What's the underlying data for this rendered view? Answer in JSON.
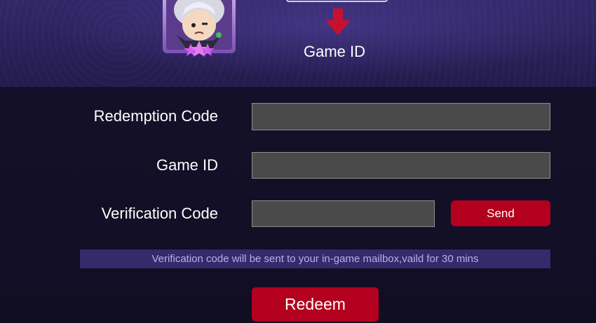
{
  "hero": {
    "game_id_label": "Game ID",
    "avatar_icon": "hero-avatar-icon",
    "arrow_icon": "down-arrow-icon",
    "arrow_color": "#c8102e"
  },
  "form": {
    "redemption_label": "Redemption Code",
    "redemption_value": "",
    "game_id_label": "Game ID",
    "game_id_value": "",
    "verification_label": "Verification Code",
    "verification_value": "",
    "send_label": "Send",
    "hint": "Verification code will be sent to your in-game mailbox,vaild for 30 mins",
    "redeem_label": "Redeem"
  },
  "colors": {
    "accent": "#b3001e",
    "hint_bar": "#342b6a",
    "field_bg": "#4a4a4a",
    "page_bg": "#120f27"
  }
}
